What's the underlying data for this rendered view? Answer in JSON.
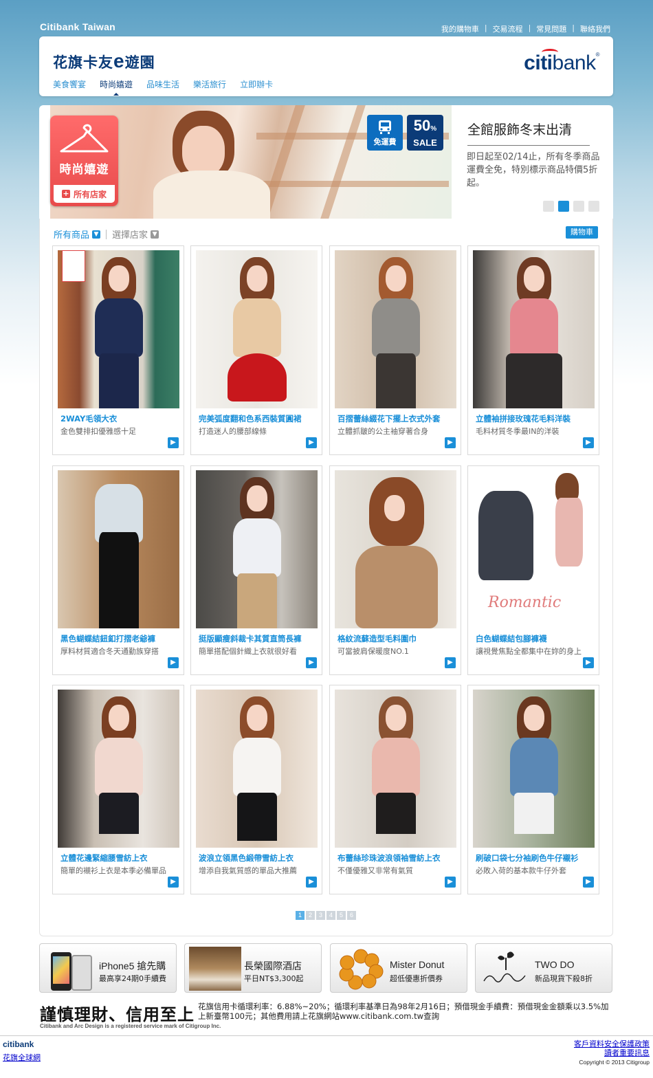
{
  "topbar": {
    "brand": "Citibank Taiwan",
    "links": [
      "我的購物車",
      "交易流程",
      "常見問題",
      "聯絡我們"
    ]
  },
  "header": {
    "title_pre": "花旗卡友",
    "title_e": "e",
    "title_post": "遊園",
    "logo_c": "citi",
    "logo_rest": "bank",
    "nav": [
      "美食饗宴",
      "時尚嬉遊",
      "品味生活",
      "樂活旅行",
      "立即辦卡"
    ],
    "active_nav": "時尚嬉遊"
  },
  "hero": {
    "category": "時尚嬉遊",
    "all_stores": "所有店家",
    "badge_free_shipping": "免運費",
    "badge_pct": "50",
    "badge_pct_sign": "%",
    "badge_sale": "SALE",
    "title": "全館服飾冬末出清",
    "description": "即日起至02/14止，所有冬季商品運費全免，特別標示商品特價5折起。",
    "slides": 4,
    "active_slide": 2
  },
  "filters": {
    "all_products": "所有商品",
    "choose_store": "選擇店家",
    "cart": "購物車"
  },
  "products": [
    {
      "title": "2WAY毛領大衣",
      "subtitle": "金色雙排扣優雅感十足"
    },
    {
      "title": "完美弧度翻和色系西裝質圓裙",
      "subtitle": "打造迷人的腰部線條"
    },
    {
      "title": "百摺蕾絲綴花下擺上衣式外套",
      "subtitle": "立體抓皺的公主袖穿著合身"
    },
    {
      "title": "立體袖拼接玫瑰花毛料洋裝",
      "subtitle": "毛料材質冬季最IN的洋裝"
    },
    {
      "title": "黑色蝴蝶結鈕釦打摺老爺褲",
      "subtitle": "厚料材質適合冬天通勤族穿搭"
    },
    {
      "title": "挺版顯瘦斜裁卡其質直筒長褲",
      "subtitle": "簡單搭配個針織上衣就很好看"
    },
    {
      "title": "格紋流蘇造型毛料圍巾",
      "subtitle": "可當披肩保暖度NO.1"
    },
    {
      "title": "白色蝴蝶結包腳褲襪",
      "subtitle": "讓視覺焦點全都集中在妳的身上",
      "overlay": "Romantic"
    },
    {
      "title": "立體花邊緊縮腰雪紡上衣",
      "subtitle": "簡單的襯衫上衣是本季必備單品"
    },
    {
      "title": "波浪立領黑色緞帶雪紡上衣",
      "subtitle": "增添自我氣質感的單品大推薦"
    },
    {
      "title": "布蕾絲珍珠波浪領袖雪紡上衣",
      "subtitle": "不僅優雅又非常有氣質"
    },
    {
      "title": "刷破口袋七分袖刷色牛仔襯衫",
      "subtitle": "必敗入荷的基本款牛仔外套"
    }
  ],
  "pager": [
    "1",
    "2",
    "3",
    "4",
    "5",
    "6"
  ],
  "promos": [
    {
      "title": "iPhone5 搶先購",
      "subtitle": "最高享24期0手續費"
    },
    {
      "title": "長榮國際酒店",
      "subtitle": "平日NT$3,300起"
    },
    {
      "title": "Mister Donut",
      "subtitle": "超低優惠折價券"
    },
    {
      "title": "TWO DO",
      "subtitle": "新品現貨下殺8折"
    }
  ],
  "disclaimer": {
    "slogan": "謹慎理財、信用至上",
    "legal": "花旗信用卡循環利率：6.88%~20%；循環利率基準日為98年2月16日；預借現金手續費：預借現金金額乘以3.5%加上新臺幣100元；其他費用請上花旗網站www.citibank.com.tw查詢",
    "trademark": "Citibank and Arc Design is a registered service mark of Citigroup Inc."
  },
  "footer": {
    "logo": "citibank",
    "global": "花旗全球網",
    "privacy": "客戶資料安全保護政策",
    "notice": "讀者重要訊息",
    "copyright": "Copyright © 2013 Citigroup"
  }
}
